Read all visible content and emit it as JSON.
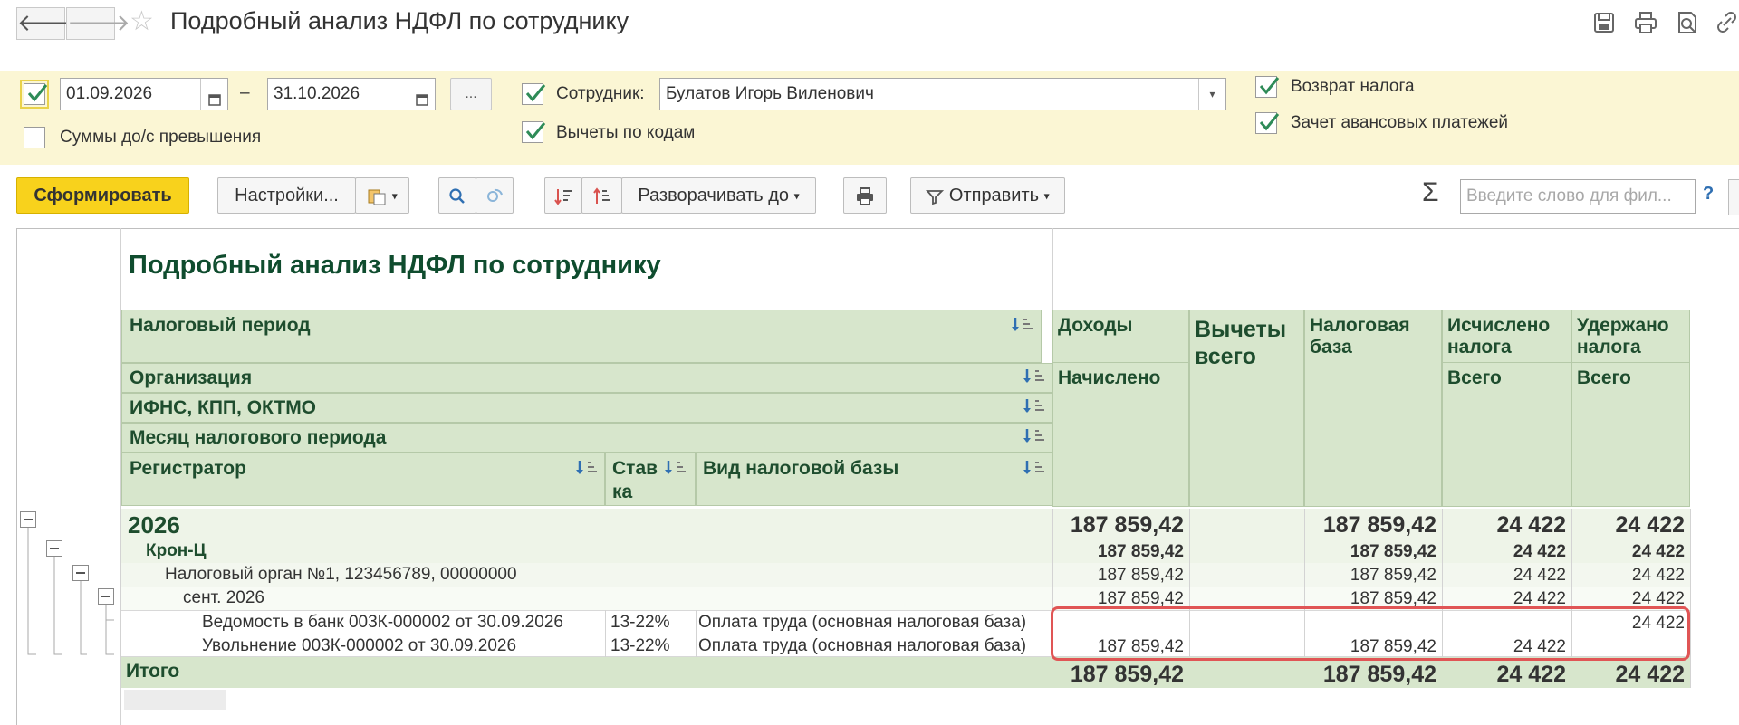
{
  "window": {
    "title": "Подробный анализ НДФЛ по сотруднику",
    "back_glyph": "🡐",
    "forward_glyph": "🡒",
    "star_glyph": "☆",
    "icons": [
      "save-icon",
      "print-icon",
      "preview-icon",
      "link-icon"
    ]
  },
  "filters": {
    "date_from": "01.09.2026",
    "date_sep": "–",
    "date_to": "31.10.2026",
    "ellipsis": "...",
    "employee_label": "Сотрудник:",
    "employee_value": "Булатов Игорь Виленович",
    "refund_label": "Возврат налога",
    "advance_label": "Зачет авансовых платежей",
    "deductions_label": "Вычеты по кодам",
    "amounts_label": "Суммы до/с превышения"
  },
  "toolbar": {
    "generate": "Сформировать",
    "settings": "Настройки...",
    "expand_to": "Разворачивать до",
    "send": "Отправить",
    "caret": "▾",
    "sigma": "Σ",
    "search_placeholder": "Введите слово для фил...",
    "help": "?"
  },
  "report": {
    "title": "Подробный анализ НДФЛ по сотруднику",
    "headers": {
      "tax_period": "Налоговый период",
      "organization": "Организация",
      "ifns": "ИФНС, КПП, ОКТМО",
      "month": "Месяц налогового периода",
      "registrar": "Регистратор",
      "rate_1": "Став",
      "rate_2": "ка",
      "base_type": "Вид налоговой базы",
      "income": "Доходы",
      "accrued": "Начислено",
      "deductions_1": "Вычеты",
      "deductions_2": "всего",
      "tax_base_1": "Налоговая",
      "tax_base_2": "база",
      "calc_1": "Исчислено",
      "calc_2": "налога",
      "calc_total": "Всего",
      "held_1": "Удержано",
      "held_2": "налога",
      "held_total": "Всего"
    },
    "rows": {
      "year": {
        "label": "2026",
        "income": "187 859,42",
        "deductions": "",
        "base": "187 859,42",
        "calc": "24 422",
        "held": "24 422"
      },
      "org": {
        "label": "Крон-Ц",
        "income": "187 859,42",
        "deductions": "",
        "base": "187 859,42",
        "calc": "24 422",
        "held": "24 422"
      },
      "ifns": {
        "label": "Налоговый орган №1, 123456789, 00000000",
        "income": "187 859,42",
        "deductions": "",
        "base": "187 859,42",
        "calc": "24 422",
        "held": "24 422"
      },
      "month": {
        "label": "сент. 2026",
        "income": "187 859,42",
        "deductions": "",
        "base": "187 859,42",
        "calc": "24 422",
        "held": "24 422"
      },
      "doc1": {
        "label": "Ведомость в банк 003К-000002 от 30.09.2026",
        "rate": "13-22%",
        "base_type": "Оплата труда (основная налоговая база)",
        "income": "",
        "deductions": "",
        "base": "",
        "calc": "",
        "held": "24 422"
      },
      "doc2": {
        "label": "Увольнение 003К-000002 от 30.09.2026",
        "rate": "13-22%",
        "base_type": "Оплата труда (основная налоговая база)",
        "income": "187 859,42",
        "deductions": "",
        "base": "187 859,42",
        "calc": "24 422",
        "held": ""
      },
      "total": {
        "label": "Итого",
        "income": "187 859,42",
        "deductions": "",
        "base": "187 859,42",
        "calc": "24 422",
        "held": "24 422"
      }
    }
  },
  "colors": {
    "accent_yellow": "#f8d21c",
    "header_green": "#d7e6cc",
    "title_green": "#0f4c2e",
    "highlight_red": "#e05555",
    "filter_bg": "#fbf6d4"
  }
}
